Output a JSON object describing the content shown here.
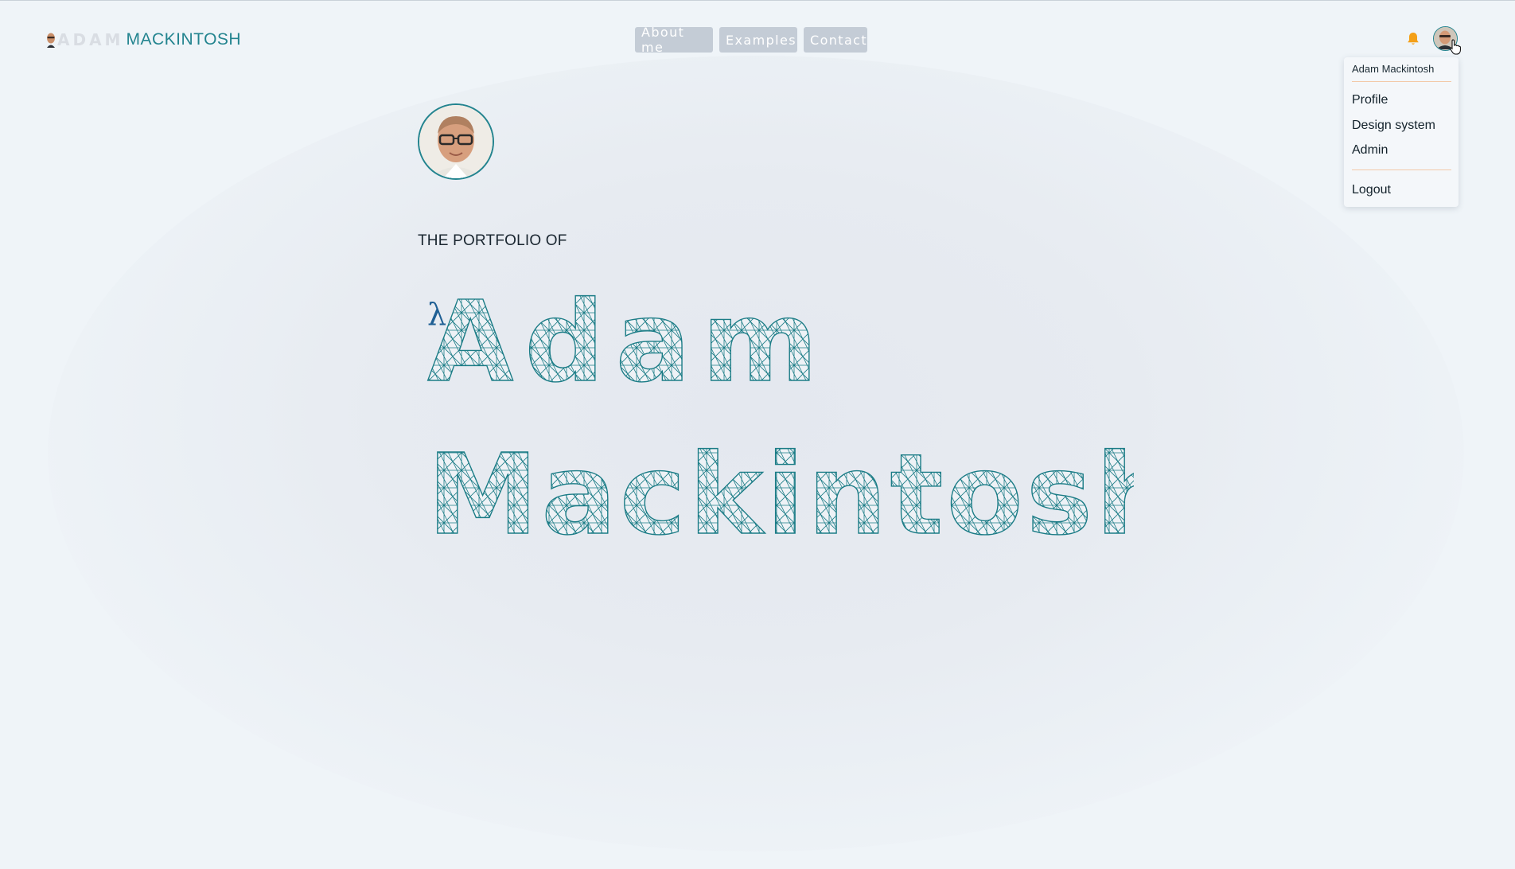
{
  "brand": {
    "first_name": "ADAM",
    "last_name": "MACKINTOSH"
  },
  "nav": {
    "items": [
      {
        "label": "About me"
      },
      {
        "label": "Examples"
      },
      {
        "label": "Contact"
      }
    ]
  },
  "header": {
    "notification_icon": "bell-icon",
    "avatar_icon": "user-avatar"
  },
  "dropdown": {
    "user_name": "Adam Mackintosh",
    "items": [
      {
        "label": "Profile"
      },
      {
        "label": "Design system"
      },
      {
        "label": "Admin"
      }
    ],
    "logout_label": "Logout"
  },
  "hero": {
    "eyebrow": "THE PORTFOLIO OF",
    "symbol": "λ",
    "first_name": "Adam",
    "last_name": "Mackintosh"
  },
  "colors": {
    "brand_teal": "#23848f",
    "nav_button_bg": "#c4ccd6",
    "bell_orange": "#f4a018",
    "lambda_blue": "#1f5f94",
    "separator": "#f3c9a8",
    "page_bg": "#eff4f8"
  }
}
